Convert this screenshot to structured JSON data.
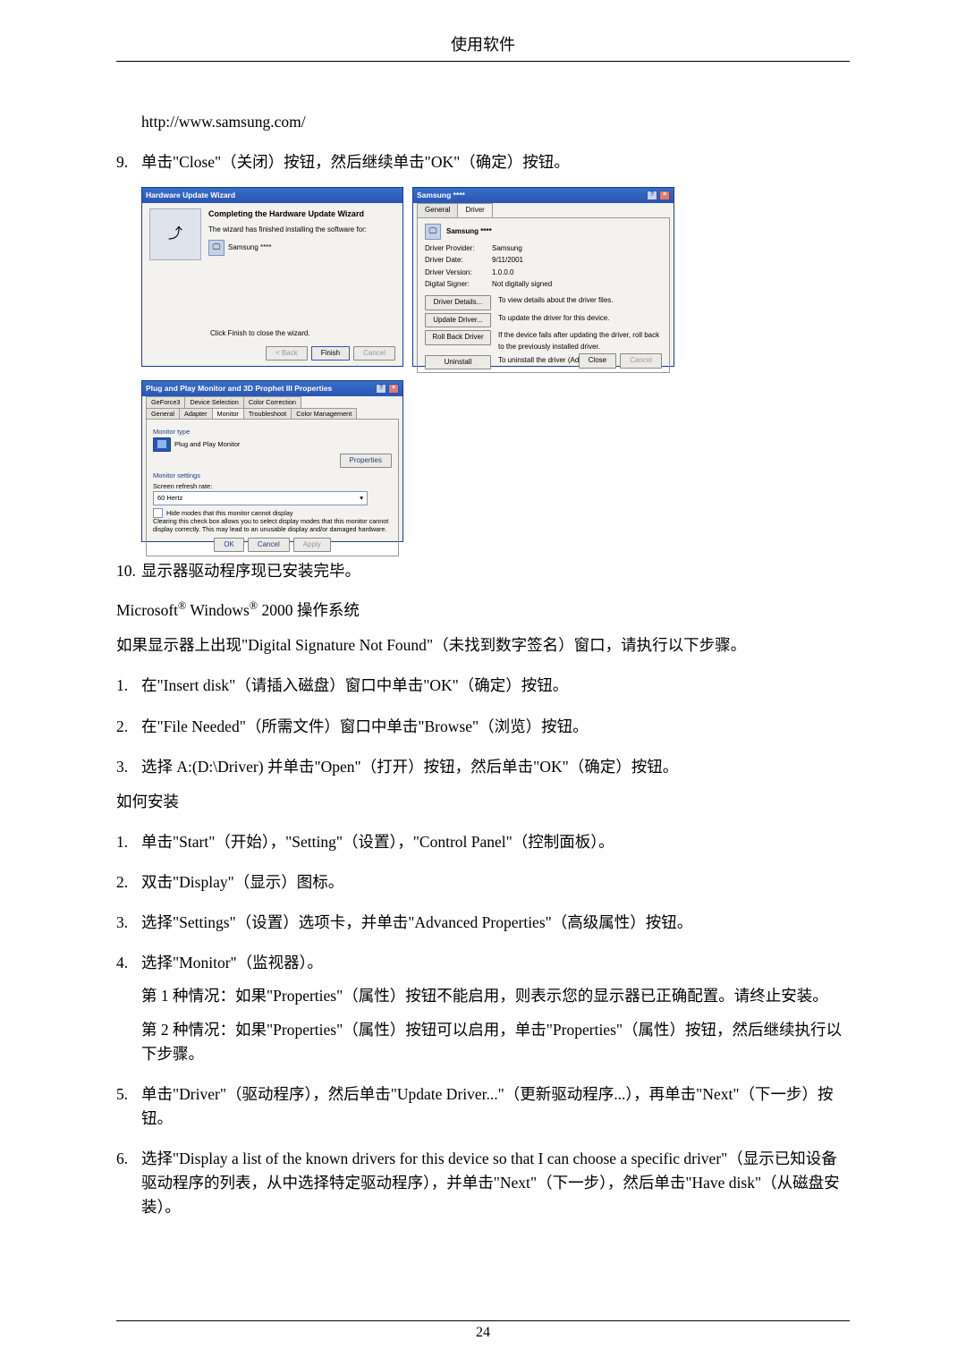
{
  "header": {
    "title": "使用软件"
  },
  "pre": {
    "url": "http://www.samsung.com/",
    "item9_num": "9.",
    "item9_text_a": "单击\"",
    "item9_close": "Close",
    "item9_text_b": "\"（关闭）按钮，然后继续单击\"",
    "item9_ok": "OK",
    "item9_text_c": "\"（确定）按钮。"
  },
  "wizard": {
    "title": "Hardware Update Wizard",
    "h": "Completing the Hardware Update Wizard",
    "line1": "The wizard has finished installing the software for:",
    "device": "Samsung ****",
    "line2": "Click Finish to close the wizard.",
    "back": "< Back",
    "finish": "Finish",
    "cancel": "Cancel"
  },
  "drv": {
    "title": "Samsung ****",
    "tab_general": "General",
    "tab_driver": "Driver",
    "name": "Samsung ****",
    "provider_k": "Driver Provider:",
    "provider_v": "Samsung",
    "date_k": "Driver Date:",
    "date_v": "9/11/2001",
    "version_k": "Driver Version:",
    "version_v": "1.0.0.0",
    "signer_k": "Digital Signer:",
    "signer_v": "Not digitally signed",
    "btn_details": "Driver Details...",
    "btn_details_d": "To view details about the driver files.",
    "btn_update": "Update Driver...",
    "btn_update_d": "To update the driver for this device.",
    "btn_rollback": "Roll Back Driver",
    "btn_rollback_d": "If the device fails after updating the driver, roll back to the previously installed driver.",
    "btn_uninstall": "Uninstall",
    "btn_uninstall_d": "To uninstall the driver (Advanced).",
    "close": "Close",
    "cancel": "Cancel"
  },
  "pnp": {
    "title": "Plug and Play Monitor and 3D Prophet III Properties",
    "tabs_row1": [
      "GeForce3",
      "Device Selection",
      "Color Correction"
    ],
    "tabs_row2": [
      "General",
      "Adapter",
      "Monitor",
      "Troubleshoot",
      "Color Management"
    ],
    "grp_type": "Monitor type",
    "mon_name": "Plug and Play Monitor",
    "btn_props": "Properties",
    "grp_settings": "Monitor settings",
    "refresh_lbl": "Screen refresh rate:",
    "refresh_val": "60 Hertz",
    "chk": "Hide modes that this monitor cannot display",
    "note": "Clearing this check box allows you to select display modes that this monitor cannot display correctly. This may lead to an unusable display and/or damaged hardware.",
    "ok": "OK",
    "cancel": "Cancel",
    "apply": "Apply"
  },
  "post": {
    "item10_num": "10.",
    "item10_text": "显示器驱动程序现已安装完毕。",
    "os_a": "Microsoft",
    "os_b": " Windows",
    "os_c": " 2000 操作系统",
    "dsnf_a": "如果显示器上出现\"",
    "dsnf_b": "Digital Signature Not Found",
    "dsnf_c": "\"（未找到数字签名）窗口，请执行以下步骤。",
    "n1_num": "1.",
    "n1": "在\"",
    "n1_en": "Insert disk",
    "n1_b": "\"（请插入磁盘）窗口中单击\"",
    "n1_ok": "OK",
    "n1_c": "\"（确定）按钮。",
    "n2_num": "2.",
    "n2": "在\"",
    "n2_en": "File Needed",
    "n2_b": "\"（所需文件）窗口中单击\"",
    "n2_browse": "Browse",
    "n2_c": "\"（浏览）按钮。",
    "n3_num": "3.",
    "n3_a": "选择 ",
    "n3_path": "A:(D:\\Driver)",
    "n3_b": " 并单击\"",
    "n3_open": "Open",
    "n3_c": "\"（打开）按钮，然后单击\"",
    "n3_ok": "OK",
    "n3_d": "\"（确定）按钮。",
    "howto": "如何安装",
    "h1_num": "1.",
    "h1_a": "单击\"",
    "h1_start": "Start",
    "h1_b": "\"（开始），\"",
    "h1_setting": "Setting",
    "h1_c": "\"（设置），\"",
    "h1_cp": "Control Panel",
    "h1_d": "\"（控制面板）。",
    "h2_num": "2.",
    "h2_a": "双击\"",
    "h2_display": "Display",
    "h2_b": "\"（显示）图标。",
    "h3_num": "3.",
    "h3_a": "选择\"",
    "h3_settings": "Settings",
    "h3_b": "\"（设置）选项卡，并单击\"",
    "h3_adv": "Advanced Properties",
    "h3_c": "\"（高级属性）按钮。",
    "h4_num": "4.",
    "h4_a": "选择\"",
    "h4_monitor": "Monitor",
    "h4_b": "\"（监视器）。",
    "case1_a": "第 1 种情况：如果\"",
    "case1_prop": "Properties",
    "case1_b": "\"（属性）按钮不能启用，则表示您的显示器已正确配置。请终止安装。",
    "case2_a": "第 2 种情况：如果\"",
    "case2_prop": "Properties",
    "case2_b": "\"（属性）按钮可以启用，单击\"",
    "case2_prop2": "Properties",
    "case2_c": "\"（属性）按钮，然后继续执行以下步骤。",
    "h5_num": "5.",
    "h5_a": "单击\"",
    "h5_driver": "Driver",
    "h5_b": "\"（驱动程序），然后单击\"",
    "h5_update": "Update Driver...",
    "h5_c": "\"（更新驱动程序...），再单击\"",
    "h5_next": "Next",
    "h5_d": "\"（下一步）按钮。",
    "h6_num": "6.",
    "h6_a": "选择\"",
    "h6_list": "Display a list of the known drivers for this device so that I can choose a specific driver",
    "h6_b": "\"（显示已知设备驱动程序的列表，从中选择特定驱动程序），并单击\"",
    "h6_next": "Next",
    "h6_c": "\"（下一步），然后单击\"",
    "h6_have": "Have disk",
    "h6_d": "\"（从磁盘安装）。"
  },
  "footer": {
    "page": "24"
  }
}
